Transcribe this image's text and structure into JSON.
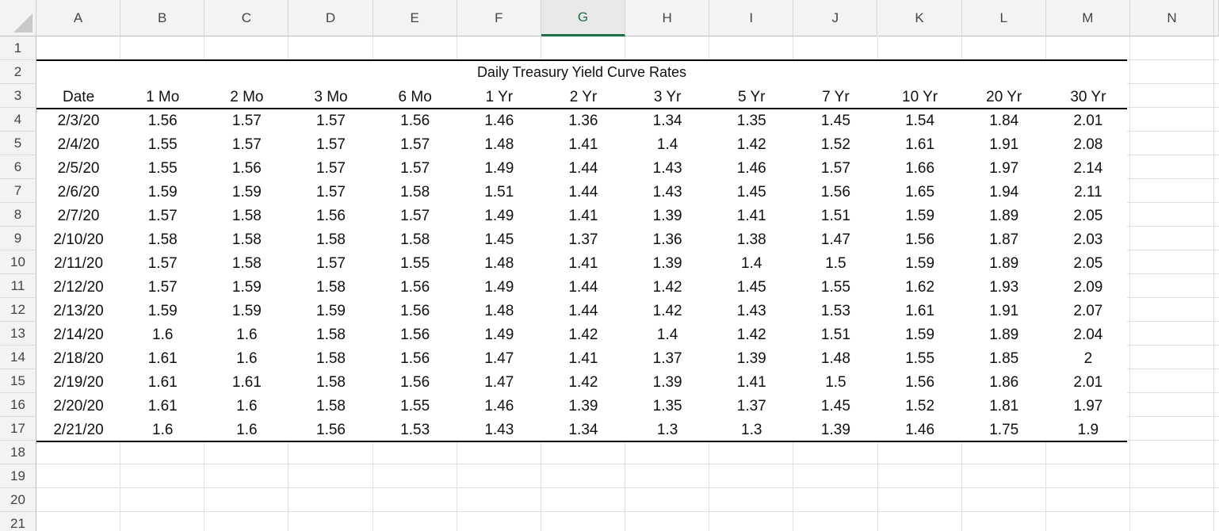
{
  "columns": [
    "A",
    "B",
    "C",
    "D",
    "E",
    "F",
    "G",
    "H",
    "I",
    "J",
    "K",
    "L",
    "M",
    "N"
  ],
  "selected_column": "G",
  "rows": [
    "1",
    "2",
    "3",
    "4",
    "5",
    "6",
    "7",
    "8",
    "9",
    "10",
    "11",
    "12",
    "13",
    "14",
    "15",
    "16",
    "17",
    "18",
    "19",
    "20",
    "21"
  ],
  "table": {
    "title": "Daily Treasury Yield Curve Rates",
    "headers": [
      "Date",
      "1 Mo",
      "2 Mo",
      "3 Mo",
      "6 Mo",
      "1 Yr",
      "2 Yr",
      "3 Yr",
      "5 Yr",
      "7 Yr",
      "10 Yr",
      "20 Yr",
      "30 Yr"
    ],
    "data": [
      [
        "2/3/20",
        "1.56",
        "1.57",
        "1.57",
        "1.56",
        "1.46",
        "1.36",
        "1.34",
        "1.35",
        "1.45",
        "1.54",
        "1.84",
        "2.01"
      ],
      [
        "2/4/20",
        "1.55",
        "1.57",
        "1.57",
        "1.57",
        "1.48",
        "1.41",
        "1.4",
        "1.42",
        "1.52",
        "1.61",
        "1.91",
        "2.08"
      ],
      [
        "2/5/20",
        "1.55",
        "1.56",
        "1.57",
        "1.57",
        "1.49",
        "1.44",
        "1.43",
        "1.46",
        "1.57",
        "1.66",
        "1.97",
        "2.14"
      ],
      [
        "2/6/20",
        "1.59",
        "1.59",
        "1.57",
        "1.58",
        "1.51",
        "1.44",
        "1.43",
        "1.45",
        "1.56",
        "1.65",
        "1.94",
        "2.11"
      ],
      [
        "2/7/20",
        "1.57",
        "1.58",
        "1.56",
        "1.57",
        "1.49",
        "1.41",
        "1.39",
        "1.41",
        "1.51",
        "1.59",
        "1.89",
        "2.05"
      ],
      [
        "2/10/20",
        "1.58",
        "1.58",
        "1.58",
        "1.58",
        "1.45",
        "1.37",
        "1.36",
        "1.38",
        "1.47",
        "1.56",
        "1.87",
        "2.03"
      ],
      [
        "2/11/20",
        "1.57",
        "1.58",
        "1.57",
        "1.55",
        "1.48",
        "1.41",
        "1.39",
        "1.4",
        "1.5",
        "1.59",
        "1.89",
        "2.05"
      ],
      [
        "2/12/20",
        "1.57",
        "1.59",
        "1.58",
        "1.56",
        "1.49",
        "1.44",
        "1.42",
        "1.45",
        "1.55",
        "1.62",
        "1.93",
        "2.09"
      ],
      [
        "2/13/20",
        "1.59",
        "1.59",
        "1.59",
        "1.56",
        "1.48",
        "1.44",
        "1.42",
        "1.43",
        "1.53",
        "1.61",
        "1.91",
        "2.07"
      ],
      [
        "2/14/20",
        "1.6",
        "1.6",
        "1.58",
        "1.56",
        "1.49",
        "1.42",
        "1.4",
        "1.42",
        "1.51",
        "1.59",
        "1.89",
        "2.04"
      ],
      [
        "2/18/20",
        "1.61",
        "1.6",
        "1.58",
        "1.56",
        "1.47",
        "1.41",
        "1.37",
        "1.39",
        "1.48",
        "1.55",
        "1.85",
        "2"
      ],
      [
        "2/19/20",
        "1.61",
        "1.61",
        "1.58",
        "1.56",
        "1.47",
        "1.42",
        "1.39",
        "1.41",
        "1.5",
        "1.56",
        "1.86",
        "2.01"
      ],
      [
        "2/20/20",
        "1.61",
        "1.6",
        "1.58",
        "1.55",
        "1.46",
        "1.39",
        "1.35",
        "1.37",
        "1.45",
        "1.52",
        "1.81",
        "1.97"
      ],
      [
        "2/21/20",
        "1.6",
        "1.6",
        "1.56",
        "1.53",
        "1.43",
        "1.34",
        "1.3",
        "1.3",
        "1.39",
        "1.46",
        "1.75",
        "1.9"
      ]
    ]
  },
  "colors": {
    "selected_accent": "#1e7145",
    "gridline": "#e0e0e0",
    "header_bg": "#f3f3f3"
  }
}
